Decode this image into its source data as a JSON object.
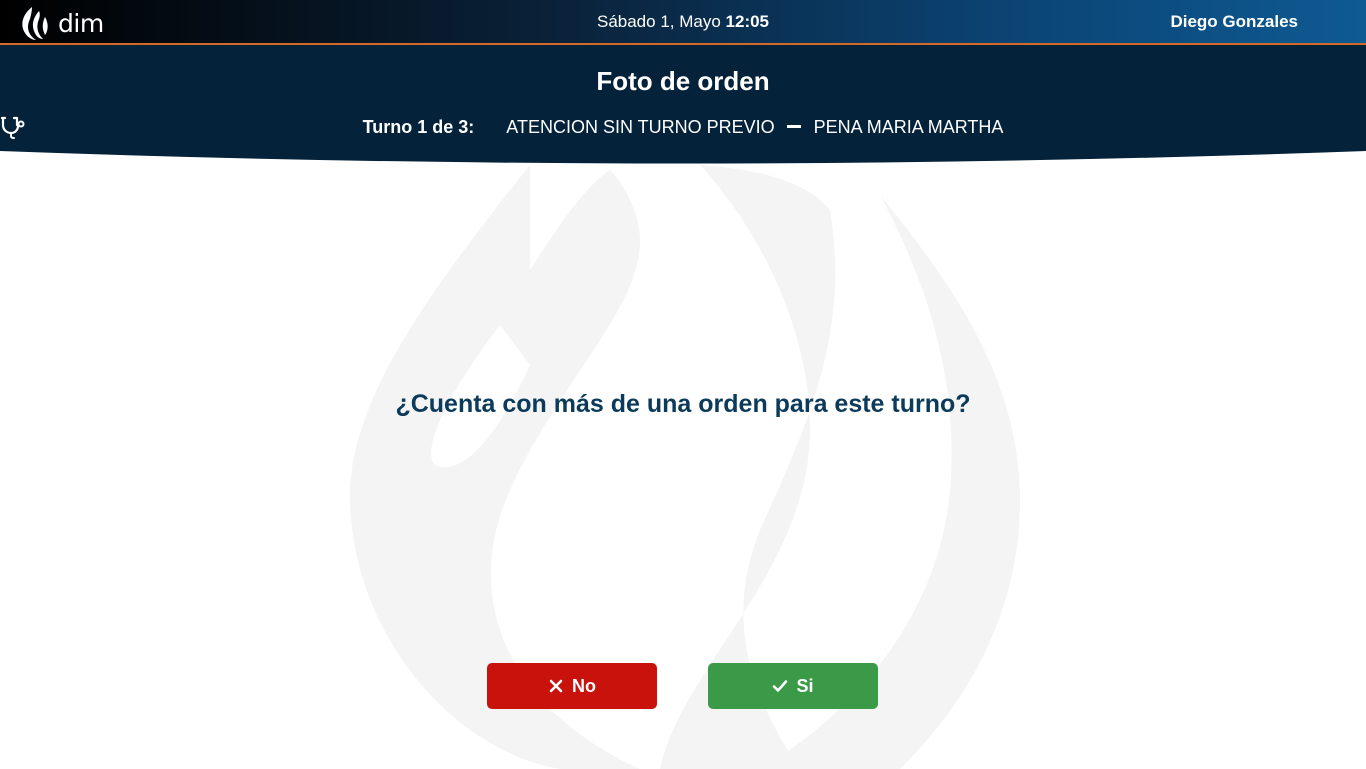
{
  "app": {
    "logo_text": "dim"
  },
  "topbar": {
    "date": "Sábado 1, Mayo",
    "time": "12:05",
    "user_name": "Diego Gonzales"
  },
  "header": {
    "title": "Foto de orden",
    "turno_label": "Turno 1 de 3:",
    "turno_type": "ATENCION SIN TURNO PREVIO",
    "patient_name": "PENA MARIA MARTHA",
    "icon": "stethoscope-icon"
  },
  "main": {
    "question": "¿Cuenta con más de una orden para este turno?"
  },
  "actions": {
    "no_label": "No",
    "no_icon": "close-icon",
    "no_color": "#c8120b",
    "si_label": "Si",
    "si_icon": "check-icon",
    "si_color": "#3a9a48"
  },
  "colors": {
    "header_bg": "#04223a",
    "accent_line": "#d46a2a",
    "question_text": "#0b3a5b"
  }
}
